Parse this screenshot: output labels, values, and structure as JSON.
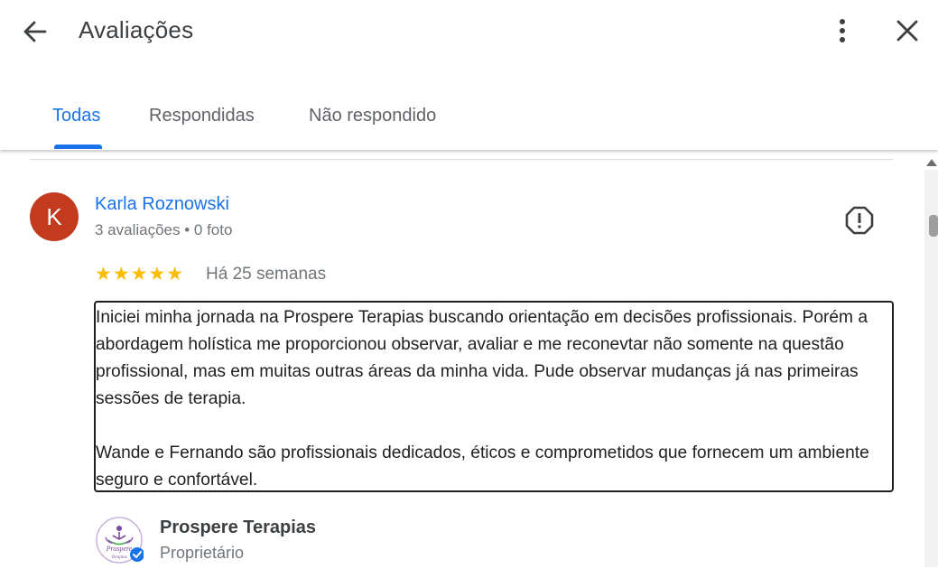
{
  "header": {
    "title": "Avaliações",
    "back_icon": "arrow-back-icon",
    "more_icon": "more-vert-icon",
    "close_icon": "close-icon"
  },
  "tabs": [
    {
      "label": "Todas",
      "active": true
    },
    {
      "label": "Respondidas",
      "active": false
    },
    {
      "label": "Não respondido",
      "active": false
    }
  ],
  "review": {
    "avatar_letter": "K",
    "avatar_color": "#c33a1e",
    "name": "Karla Roznowski",
    "meta": "3 avaliações • 0 foto",
    "rating": 5,
    "stars": "★★★★★",
    "time_ago": "Há 25 semanas",
    "text": "Iniciei minha jornada na Prospere Terapias buscando orientação em decisões profissionais. Porém a abordagem holística me proporcionou observar, avaliar e me reconevtar não somente na questão profissional, mas em muitas outras áreas da minha vida. Pude observar mudanças já nas primeiras sessões de terapia.\n\nWande e Fernando são profissionais dedicados, éticos e comprometidos que fornecem um ambiente seguro e confortável."
  },
  "owner": {
    "logo_text": "Prospere",
    "logo_subtext": "Terapias",
    "name": "Prospere Terapias",
    "role": "Proprietário"
  },
  "colors": {
    "accent": "#1a73e8",
    "star": "#fbbc04",
    "verified": "#1a73e8"
  }
}
